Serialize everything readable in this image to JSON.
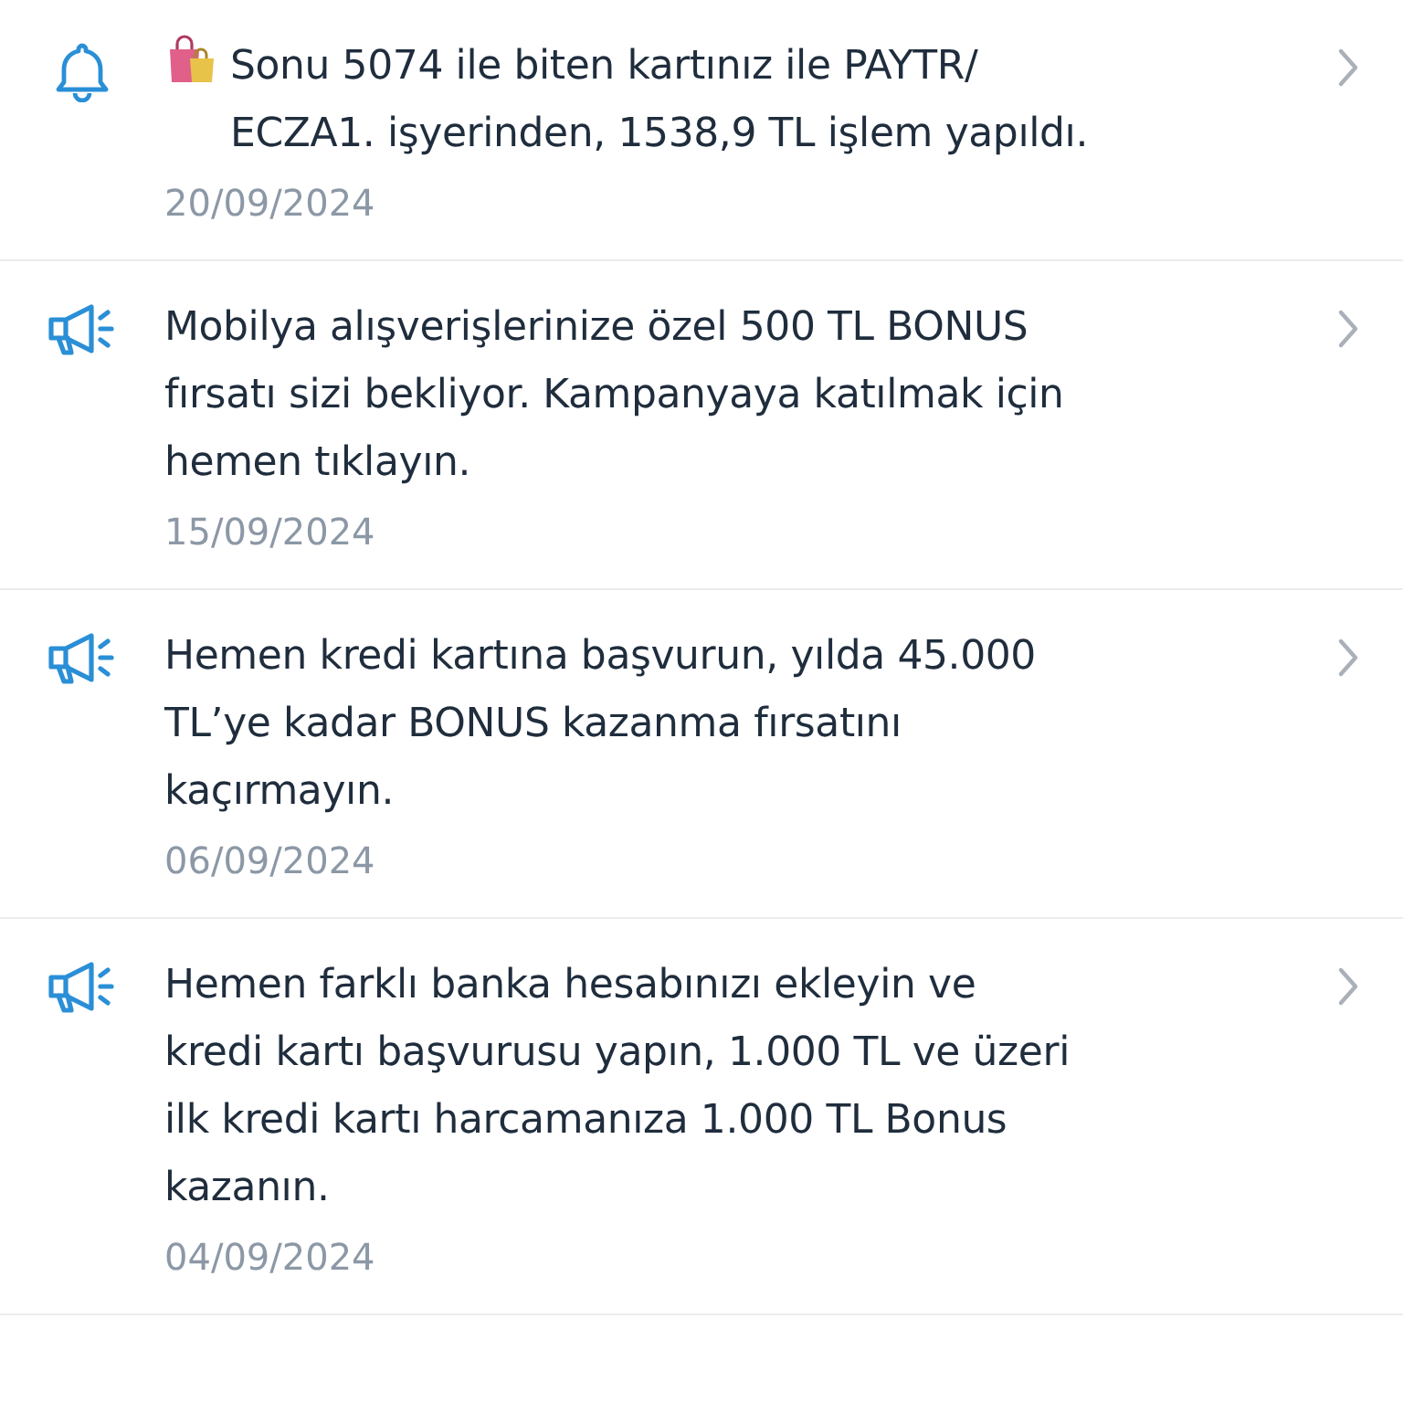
{
  "notifications": [
    {
      "kind": "transaction",
      "message": "Sonu 5074 ile biten kartınız ile PAYTR/\nECZA1. işyerinden, 1538,9 TL işlem yapıldı.",
      "date": "20/09/2024"
    },
    {
      "kind": "campaign",
      "message": "Mobilya alışverişlerinize özel 500 TL BONUS\nfırsatı sizi bekliyor. Kampanyaya katılmak için\nhemen tıklayın.",
      "date": "15/09/2024"
    },
    {
      "kind": "campaign",
      "message": "Hemen kredi kartına başvurun, yılda 45.000\nTL’ye kadar BONUS kazanma fırsatını\nkaçırmayın.",
      "date": "06/09/2024"
    },
    {
      "kind": "campaign",
      "message": "Hemen farklı banka hesabınızı ekleyin ve\nkredi kartı başvurusu yapın, 1.000 TL ve üzeri\nilk kredi kartı harcamanıza 1.000 TL Bonus\nkazanın.",
      "date": "04/09/2024"
    }
  ]
}
